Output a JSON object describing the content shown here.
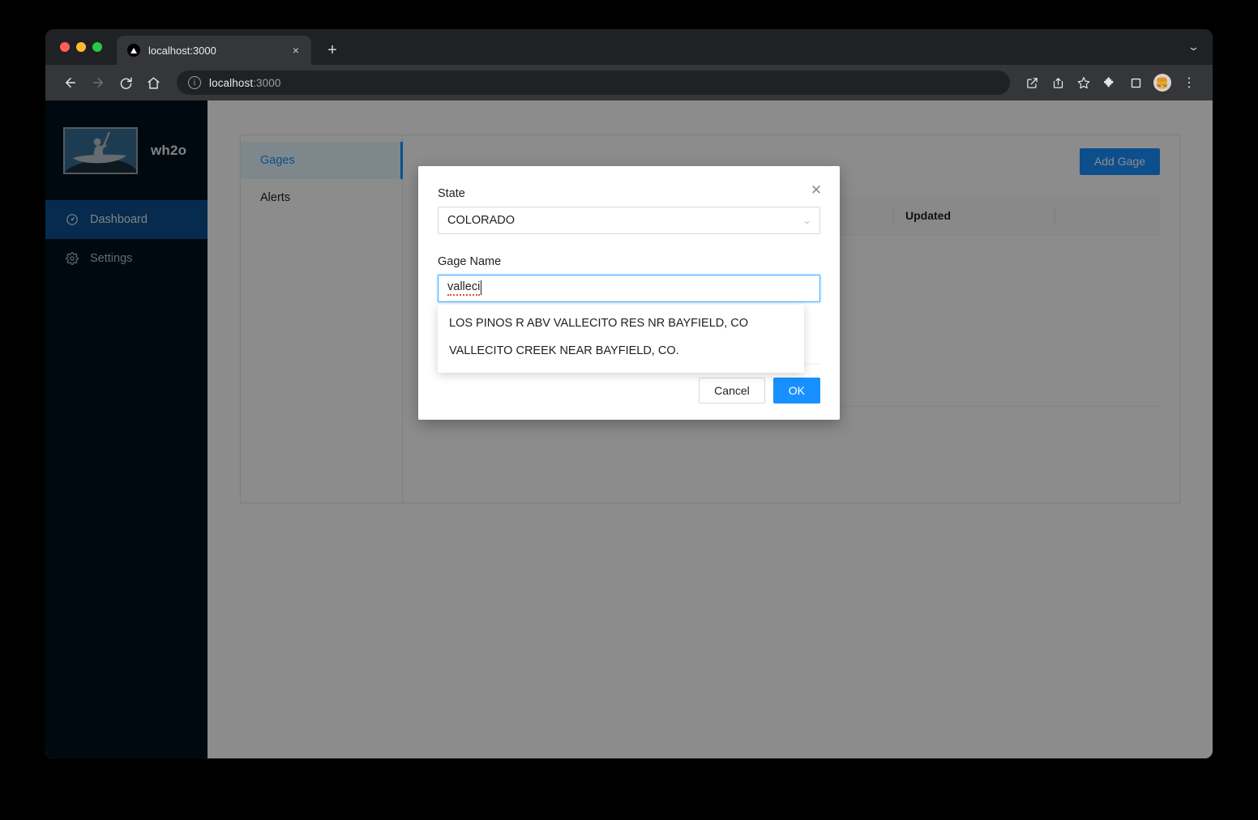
{
  "browser": {
    "tab": {
      "title": "localhost:3000",
      "favicon": "nextjs-triangle-icon",
      "close_label": "×"
    },
    "new_tab_label": "+",
    "tab_list_chevron": "⌄",
    "toolbar": {
      "back_label": "←",
      "forward_label": "→",
      "reload_label": "↻",
      "home_label": "⌂",
      "url_host": "localhost",
      "url_port": ":3000",
      "info_label": "i",
      "share_icon": "share-icon",
      "install_icon": "install-icon",
      "bookmark_icon": "star-icon",
      "extensions_icon": "puzzle-icon",
      "sidepanel_icon": "side-panel-icon",
      "avatar_glyph": "🍔",
      "menu_label": "⋮"
    }
  },
  "sidebar": {
    "brand": "wh2o",
    "logo_alt": "kayaker-logo",
    "items": [
      {
        "label": "Dashboard",
        "icon": "dashboard-icon",
        "active": true
      },
      {
        "label": "Settings",
        "icon": "gear-icon",
        "active": false
      }
    ]
  },
  "main": {
    "tabs": [
      {
        "label": "Gages",
        "active": true
      },
      {
        "label": "Alerts",
        "active": false
      }
    ],
    "add_button": "Add Gage",
    "table": {
      "columns": [
        "",
        "",
        "",
        "Updated",
        ""
      ],
      "rows": []
    }
  },
  "modal": {
    "close_label": "✕",
    "state_label": "State",
    "state_value": "COLORADO",
    "state_caret": "⌄",
    "gage_label": "Gage Name",
    "gage_value": "valleci",
    "suggestions": [
      "LOS PINOS R ABV VALLECITO RES NR BAYFIELD, CO",
      "VALLECITO CREEK NEAR BAYFIELD, CO."
    ],
    "cancel_label": "Cancel",
    "ok_label": "OK"
  },
  "colors": {
    "accent": "#1890ff",
    "sidebar_bg": "#00121c",
    "sidebar_active": "#0b4f8f",
    "page_bg": "#ffffff"
  }
}
